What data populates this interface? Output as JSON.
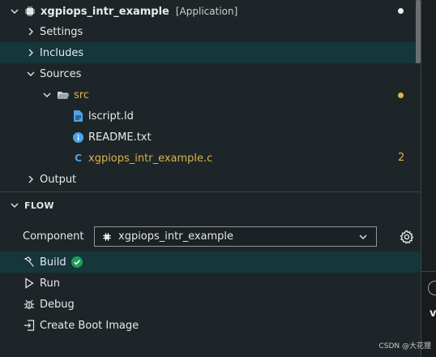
{
  "project": {
    "name": "xgpiops_intr_example",
    "tag": "[Application]"
  },
  "tree": {
    "settings": "Settings",
    "includes": "Includes",
    "sources": "Sources",
    "src_folder": "src",
    "files": [
      {
        "name": "lscript.ld",
        "icon": "file-icon"
      },
      {
        "name": "README.txt",
        "icon": "info-icon"
      },
      {
        "name": "xgpiops_intr_example.c",
        "icon": "c-file-icon",
        "badge": "2"
      }
    ],
    "output": "Output"
  },
  "flow": {
    "title": "FLOW",
    "component_label": "Component",
    "component_value": "xgpiops_intr_example",
    "actions": [
      {
        "label": "Build",
        "icon": "hammer-icon",
        "status": "check-icon"
      },
      {
        "label": "Run",
        "icon": "play-icon"
      },
      {
        "label": "Debug",
        "icon": "bug-icon"
      },
      {
        "label": "Create Boot Image",
        "icon": "boot-image-icon"
      }
    ]
  },
  "watermark": "CSDN @大花狸",
  "colors": {
    "background": "#1e2528",
    "selected_row": "#15363b",
    "modified_yellow": "#d9b547",
    "success_green": "#1f9d55",
    "file_blue": "#4da3e8"
  }
}
